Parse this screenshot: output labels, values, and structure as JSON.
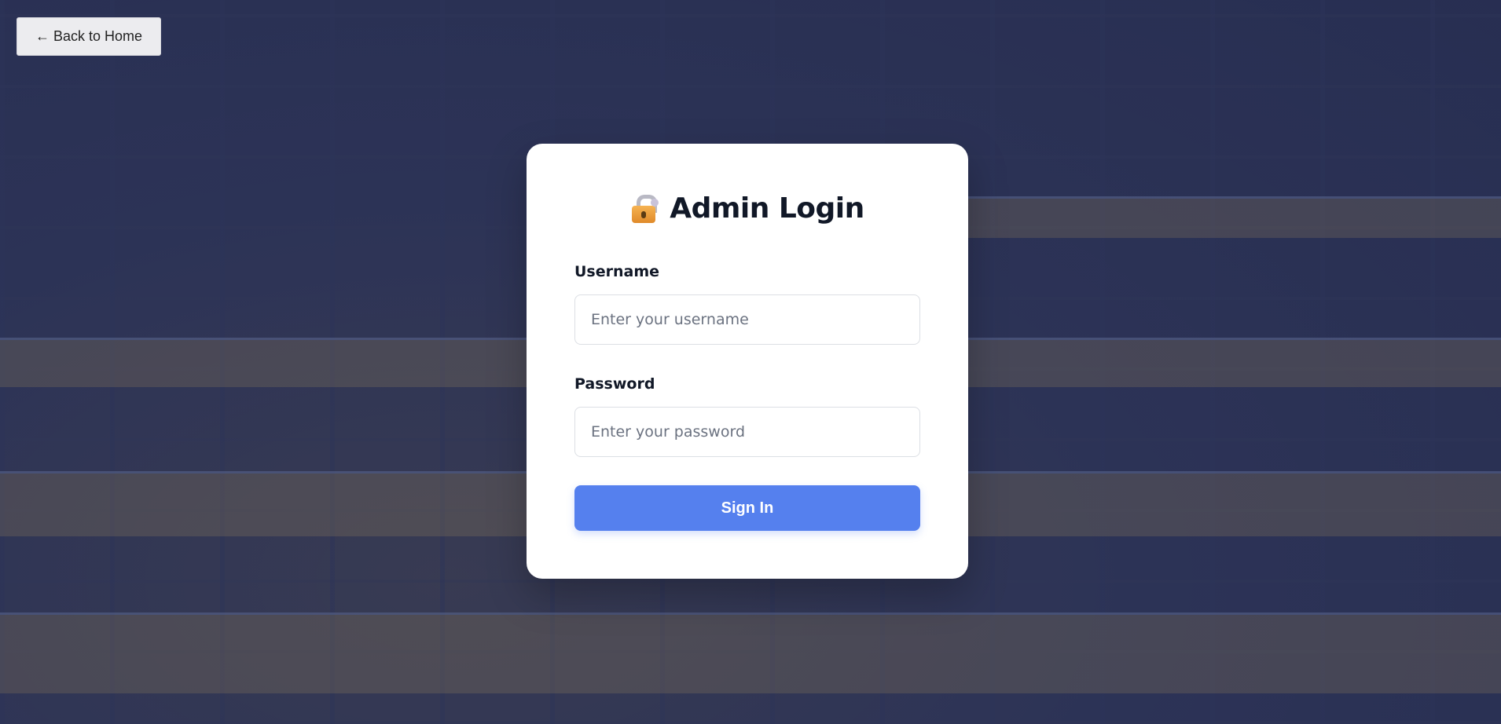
{
  "nav": {
    "back_label": "← Back to Home"
  },
  "login": {
    "title": "Admin Login",
    "title_icon": "lock-with-key-icon",
    "username_label": "Username",
    "username_placeholder": "Enter your username",
    "username_value": "",
    "password_label": "Password",
    "password_placeholder": "Enter your password",
    "password_value": "",
    "submit_label": "Sign In"
  },
  "colors": {
    "accent": "#5580ee",
    "overlay": "#262d52",
    "card": "#ffffff",
    "title_text": "#111827"
  }
}
